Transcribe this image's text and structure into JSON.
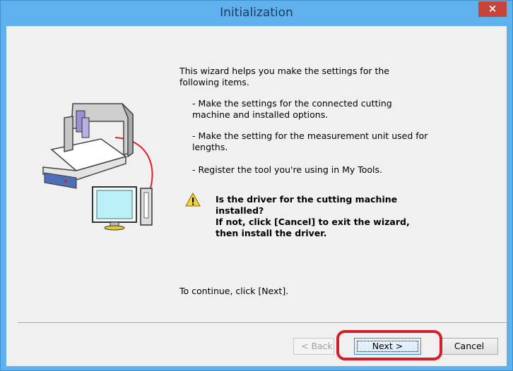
{
  "window": {
    "title": "Initialization",
    "close_label": "×"
  },
  "content": {
    "intro_line1": "This wizard helps you make the settings for the",
    "intro_line2": "following items.",
    "item1_line1": "- Make the settings for the connected cutting",
    "item1_line2": "machine and installed options.",
    "item2_line1": "- Make the setting for the measurement unit used for",
    "item2_line2": "lengths.",
    "item3": "- Register the tool you're using in My Tools.",
    "warning_line1": "Is the driver for the cutting machine",
    "warning_line2": "installed?",
    "warning_line3": "If not, click [Cancel] to exit the wizard,",
    "warning_line4": "then install the driver.",
    "continue_text": "To continue, click [Next]."
  },
  "buttons": {
    "back_label": "< Back",
    "next_label": "Next >",
    "cancel_label": "Cancel"
  },
  "icons": {
    "warning": "warning-icon",
    "illustration": "cutting-machine-computer-illustration"
  },
  "colors": {
    "titlebar": "#5eb1ec",
    "close": "#c7443a",
    "highlight": "#d41f2b"
  }
}
